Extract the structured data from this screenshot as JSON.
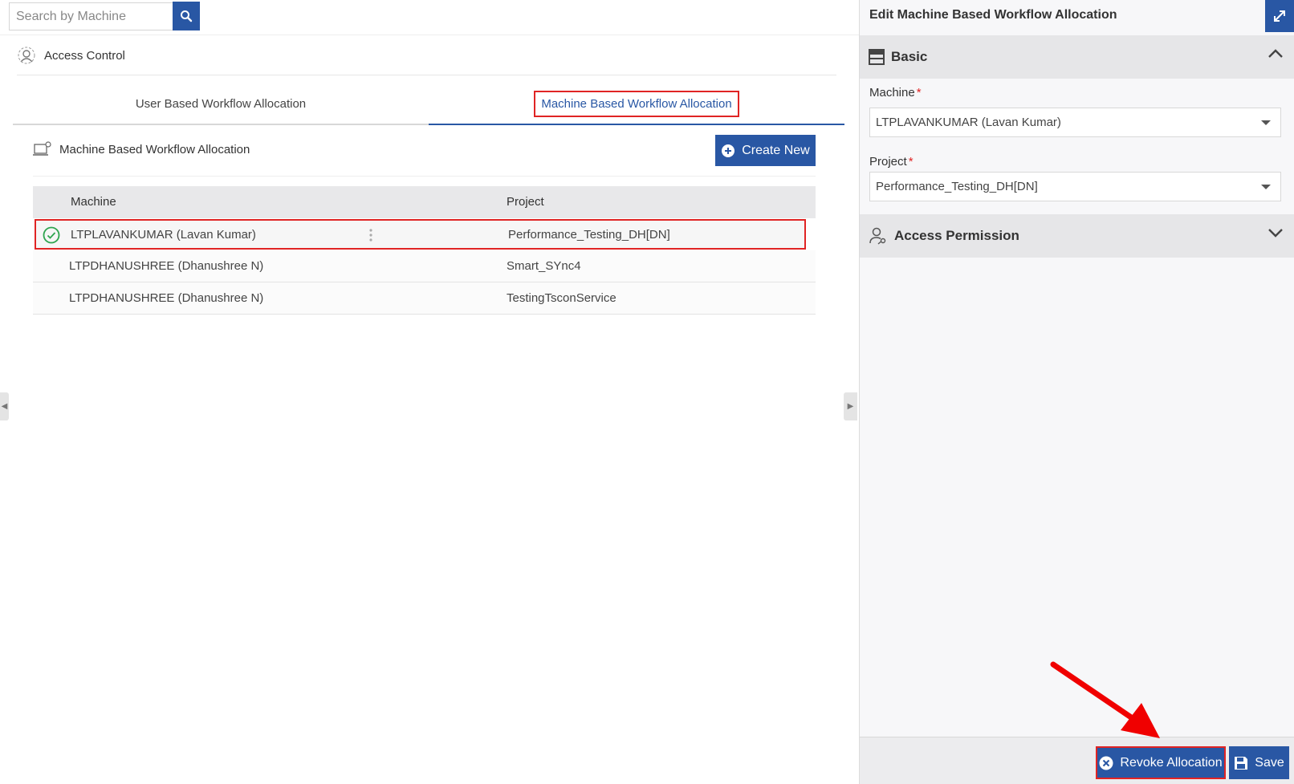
{
  "search": {
    "placeholder": "Search by Machine"
  },
  "breadcrumb": {
    "label": "Access Control"
  },
  "tabs": [
    {
      "label": "User Based Workflow Allocation"
    },
    {
      "label": "Machine Based Workflow Allocation"
    }
  ],
  "section": {
    "title": "Machine Based Workflow Allocation",
    "create_label": "Create New"
  },
  "table": {
    "columns": [
      "Machine",
      "Project"
    ],
    "rows": [
      {
        "machine": "LTPLAVANKUMAR (Lavan Kumar)",
        "project": "Performance_Testing_DH[DN]"
      },
      {
        "machine": "LTPDHANUSHREE (Dhanushree N)",
        "project": "Smart_SYnc4"
      },
      {
        "machine": "LTPDHANUSHREE (Dhanushree N)",
        "project": "TestingTsconService"
      }
    ]
  },
  "panel": {
    "title": "Edit Machine Based Workflow Allocation",
    "basic_label": "Basic",
    "machine_label": "Machine",
    "machine_value": "LTPLAVANKUMAR (Lavan Kumar)",
    "project_label": "Project",
    "project_value": "Performance_Testing_DH[DN]",
    "required_mark": "*",
    "permission_label": "Access Permission",
    "revoke_label": "Revoke Allocation",
    "save_label": "Save"
  },
  "icons": [
    "search-icon",
    "access-control-icon",
    "laptop-gear-icon",
    "plus-circle-icon",
    "check-circle-icon",
    "kebab-icon",
    "expand-icon",
    "form-icon",
    "chevron-up-icon",
    "user-key-icon",
    "chevron-down-icon",
    "close-circle-icon",
    "save-icon",
    "collapse-left-icon",
    "collapse-right-icon"
  ],
  "colors": {
    "primary": "#2957a4",
    "highlight": "#e02424",
    "success": "#2ea44f"
  }
}
